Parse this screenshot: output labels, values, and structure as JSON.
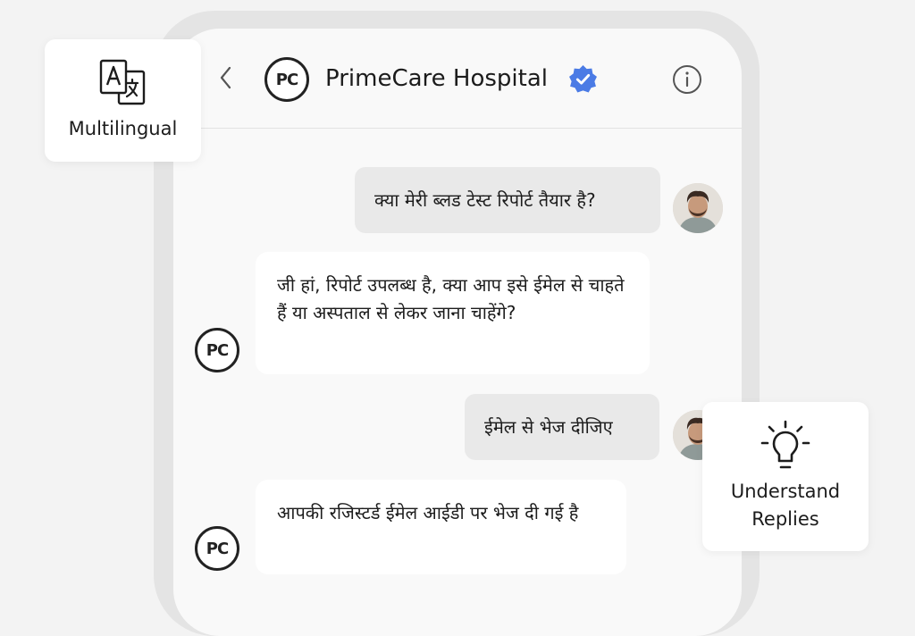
{
  "header": {
    "title": "PrimeCare Hospital",
    "avatar_initials": "PC",
    "back_icon": "chevron-left-icon",
    "verified_icon": "verified-badge-icon",
    "info_icon": "info-icon"
  },
  "messages": [
    {
      "sender": "user",
      "text": "क्या मेरी ब्लड टेस्ट रिपोर्ट तैयार है?"
    },
    {
      "sender": "hospital",
      "text": "जी हां, रिपोर्ट उपलब्ध है, क्या आप इसे ईमेल से चाहते हैं या अस्पताल से लेकर जाना चाहेंगे?"
    },
    {
      "sender": "user",
      "text": "ईमेल से भेज दीजिए"
    },
    {
      "sender": "hospital",
      "text": "आपकी रजिस्टर्ड ईमेल आईडी पर भेज दी गई है"
    }
  ],
  "features": {
    "multilingual": {
      "label": "Multilingual",
      "icon": "translate-icon"
    },
    "understand": {
      "label_line1": "Understand",
      "label_line2": "Replies",
      "icon": "lightbulb-icon"
    }
  },
  "colors": {
    "verified": "#4b7be5",
    "outgoing_bubble": "#e9e9e9",
    "incoming_bubble": "#ffffff",
    "background": "#f3f3f3"
  }
}
